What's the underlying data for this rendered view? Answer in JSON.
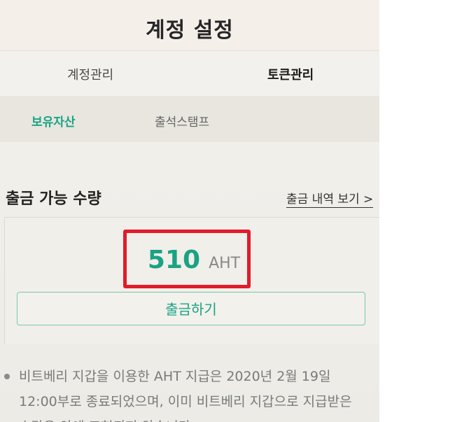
{
  "header": {
    "title": "계정 설정"
  },
  "tabs": [
    {
      "label": "계정관리",
      "active": false
    },
    {
      "label": "토큰관리",
      "active": true
    }
  ],
  "subtabs": [
    {
      "label": "보유자산",
      "active": true
    },
    {
      "label": "출석스탬프",
      "active": false
    }
  ],
  "withdraw": {
    "section_title": "출금 가능 수량",
    "history_link": "출금 내역 보기 >",
    "amount": "510",
    "unit": "AHT",
    "button_label": "출금하기"
  },
  "notice": {
    "line1": "비트베리 지갑을 이용한 AHT 지급은 2020년 2월 19일",
    "line2": "12:00부로 종료되었으며, 이미 비트베리 지갑으로 지급받은",
    "line3": "수량은 안에 표현되지 않습니다."
  },
  "colors": {
    "accent": "#1aa383",
    "highlight_box": "#e21b2a",
    "text_dark": "#222222",
    "text_muted": "#888888"
  }
}
